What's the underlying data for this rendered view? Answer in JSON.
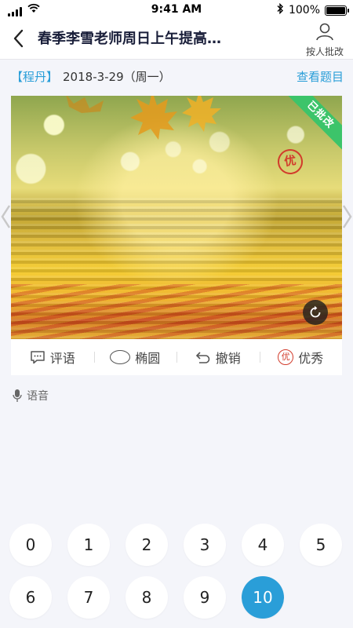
{
  "status_bar": {
    "time": "9:41 AM",
    "battery": "100%"
  },
  "nav": {
    "title": "春季李雪老师周日上午提高…",
    "person_label": "按人批改"
  },
  "header": {
    "student": "【程丹】",
    "date": "2018-3-29（周一）",
    "view_question": "查看题目"
  },
  "photo": {
    "corner_badge": "已批改",
    "grade_stamp": "优"
  },
  "toolbar": {
    "comment": "评语",
    "ellipse": "椭圆",
    "undo": "撤销",
    "excellent": "优秀",
    "excellent_icon": "优"
  },
  "voice_label": "语音",
  "scores": [
    "0",
    "1",
    "2",
    "3",
    "4",
    "5",
    "6",
    "7",
    "8",
    "9",
    "10"
  ],
  "selected_score": "10",
  "colors": {
    "accent": "#2a9ed8",
    "badge": "#3cc46a",
    "stamp": "#d23c2c"
  },
  "icons": [
    "signal-icon",
    "wifi-icon",
    "bluetooth-icon",
    "battery-icon",
    "back-icon",
    "person-icon",
    "rotate-icon",
    "comment-icon",
    "ellipse-icon",
    "undo-icon",
    "microphone-icon",
    "left-arrow-icon",
    "right-arrow-icon"
  ]
}
